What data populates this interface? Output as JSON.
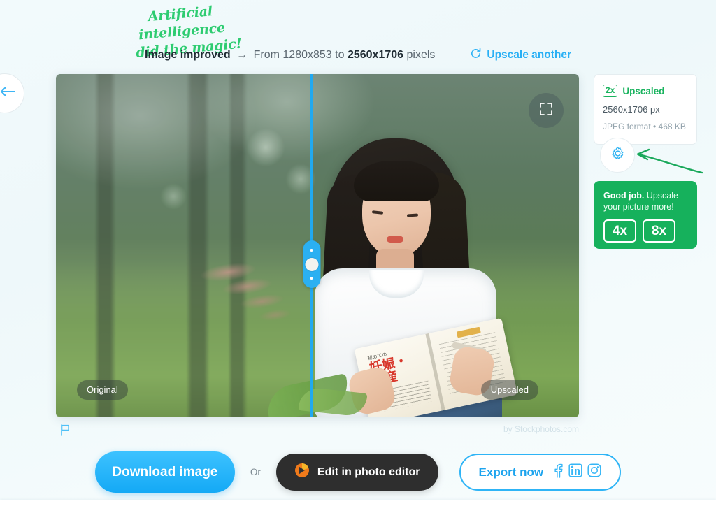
{
  "nav": {
    "back_label": "Back",
    "back_icon": "arrow-left-icon"
  },
  "promo_note": {
    "line1": "Artificial intelligence",
    "line2": "did the magic!",
    "color": "#2ecc71"
  },
  "header": {
    "status_bold": "Image improved",
    "arrow": "→",
    "from_text": "From",
    "source_size": "1280x853",
    "to_text": "to",
    "target_size": "2560x1706",
    "unit_text": "pixels",
    "upscale_another_label": "Upscale another",
    "upscale_another_icon": "refresh-icon",
    "link_color": "#29b0f5"
  },
  "viewer": {
    "fullscreen_icon": "fullscreen-expand-icon",
    "left_tag": "Original",
    "right_tag": "Upscaled",
    "divider_color": "#21a9f0",
    "slider_icon": "compare-slider-handle",
    "report_icon": "flag-icon",
    "credit": "by Stockphotos.com",
    "photo": {
      "book_title_line1": "妊娠・",
      "book_title_line2": "出産",
      "book_sub": "初めての"
    }
  },
  "info_card": {
    "badge": "2x",
    "status": "Upscaled",
    "dimensions": "2560x1706 px",
    "meta": "JPEG format • 468 KB",
    "accent_color": "#19b35e"
  },
  "settings": {
    "icon": "gear-icon",
    "label": "Settings",
    "pointer_icon": "green-curved-arrow"
  },
  "upsell": {
    "headline_bold": "Good job.",
    "headline_rest": " Upscale your picture more!",
    "options": [
      {
        "label": "4x"
      },
      {
        "label": "8x"
      }
    ],
    "background_color": "#16b15c"
  },
  "actions": {
    "download_label": "Download image",
    "or_label": "Or",
    "edit_label": "Edit in photo editor",
    "edit_icon": "photopea-icon",
    "export_label": "Export now",
    "social": [
      {
        "name": "facebook-icon"
      },
      {
        "name": "linkedin-icon"
      },
      {
        "name": "instagram-icon"
      }
    ]
  }
}
